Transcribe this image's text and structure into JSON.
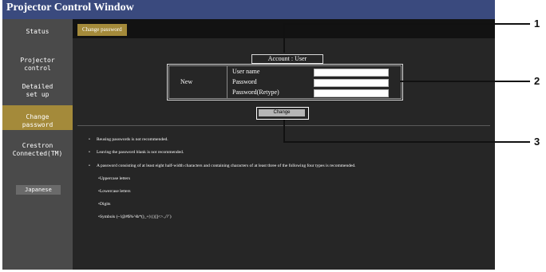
{
  "window": {
    "title": "Projector Control Window"
  },
  "sidebar": {
    "items": [
      {
        "label": "Status"
      },
      {
        "label": "Projector\ncontrol"
      },
      {
        "label": "Detailed\nset up"
      },
      {
        "label": "Change\npassword"
      },
      {
        "label": "Crestron\nConnected(TM)"
      }
    ],
    "language_button": "Japanese"
  },
  "tab": {
    "label": "Change password"
  },
  "form": {
    "account_label": "Account : User",
    "section_label": "New",
    "fields": [
      {
        "label": "User name",
        "value": ""
      },
      {
        "label": "Password",
        "value": ""
      },
      {
        "label": "Password(Retype)",
        "value": ""
      }
    ],
    "change_button": "Change"
  },
  "notes": {
    "items": [
      "Reusing passwords is not recommended.",
      "Leaving the password blank is not recommended.",
      "A password consisting of at least eight half-width characters and containing characters of at least three of the following four types is recommended."
    ],
    "types": [
      "Uppercase letters",
      "Lowercase letters",
      "Digits",
      "Symbols (~!@#$%^&*()_+|\\{}[]<>.,/?`)"
    ]
  },
  "callouts": [
    "1",
    "2",
    "3"
  ]
}
